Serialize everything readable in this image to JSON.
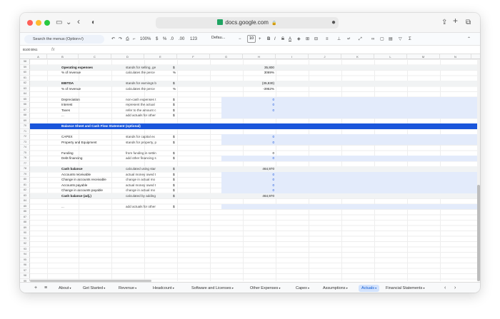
{
  "browser": {
    "url": "docs.google.com",
    "lock": "🔒"
  },
  "toolbar": {
    "search_menus": "Search the menus (Option+/)",
    "zoom": "100%",
    "currency": "$",
    "percent": "%",
    "decimal_less": ".0",
    "decimal_more": ".00",
    "number_format": "123",
    "font": "Defau...",
    "font_size": "10",
    "bold": "B",
    "italic": "I",
    "strike": "S",
    "text_color": "A",
    "minus": "−",
    "plus": "+"
  },
  "formula_bar": {
    "name_box": "B100:BN1",
    "fx": "fx"
  },
  "columns": [
    "A",
    "B",
    "C",
    "D",
    "E",
    "F",
    "G",
    "H",
    "I",
    "J",
    "K",
    "L",
    "M",
    "N"
  ],
  "row_numbers": [
    "58",
    "59",
    "60",
    "61",
    "62",
    "63",
    "64",
    "65",
    "66",
    "67",
    "68",
    "69",
    "70",
    "71",
    "72",
    "73",
    "74",
    "75",
    "76",
    "77",
    "78",
    "79",
    "80",
    "81",
    "82",
    "83",
    "84",
    "85",
    "86",
    "87",
    "88",
    "89",
    "90",
    "91",
    "92",
    "93",
    "94",
    "95",
    "96",
    "97",
    "98",
    "99"
  ],
  "rows": [
    {
      "label": "",
      "desc": "",
      "unit": "",
      "value": "",
      "style": "",
      "blue_bg": false
    },
    {
      "label": "Operating expenses",
      "desc": "stands for selling, ge",
      "unit": "$",
      "value": "35,800",
      "style": "gray bold",
      "blue_bg": false
    },
    {
      "label": "% of revenue",
      "desc": "calculates the perce",
      "unit": "%",
      "value": "3069%",
      "style": "",
      "blue_bg": false
    },
    {
      "label": "",
      "desc": "",
      "unit": "",
      "value": "",
      "style": "",
      "blue_bg": false
    },
    {
      "label": "EBITDA",
      "desc": "stands for earnings b",
      "unit": "$",
      "value": "(35,830)",
      "style": "gray bold",
      "blue_bg": false
    },
    {
      "label": "% of revenue",
      "desc": "calculates the perce",
      "unit": "%",
      "value": "-3952%",
      "style": "",
      "blue_bg": false
    },
    {
      "label": "",
      "desc": "",
      "unit": "",
      "value": "",
      "style": "",
      "blue_bg": false
    },
    {
      "label": "Depreciation",
      "desc": "non-cash expenses t",
      "unit": "$",
      "value": "0",
      "style": "",
      "blue_bg": true
    },
    {
      "label": "Interest",
      "desc": "represent the actual",
      "unit": "$",
      "value": "0",
      "style": "",
      "blue_bg": true
    },
    {
      "label": "Taxes",
      "desc": "refer to the amount c",
      "unit": "$",
      "value": "0",
      "style": "",
      "blue_bg": true
    },
    {
      "label": "...",
      "desc": "add actuals for other",
      "unit": "$",
      "value": "",
      "style": "",
      "blue_bg": true
    },
    {
      "label": "",
      "desc": "",
      "unit": "",
      "value": "",
      "style": "",
      "blue_bg": false
    },
    {
      "label": "Balance Sheet and Cash Flow Statement (optional)",
      "desc": "",
      "unit": "",
      "value": "",
      "style": "banner",
      "blue_bg": false
    },
    {
      "label": "",
      "desc": "",
      "unit": "",
      "value": "",
      "style": "",
      "blue_bg": false
    },
    {
      "label": "CAPEX",
      "desc": "stands for capital ex",
      "unit": "$",
      "value": "0",
      "style": "",
      "blue_bg": true
    },
    {
      "label": "Property and Equipment",
      "desc": "stands for property, p",
      "unit": "$",
      "value": "0",
      "style": "",
      "blue_bg": true
    },
    {
      "label": "",
      "desc": "",
      "unit": "",
      "value": "",
      "style": "",
      "blue_bg": false
    },
    {
      "label": "Funding",
      "desc": "from funding in settin",
      "unit": "$",
      "value": "0",
      "style": "",
      "blue_bg": false
    },
    {
      "label": "Debt financing",
      "desc": "add other financing s",
      "unit": "$",
      "value": "0",
      "style": "",
      "blue_bg": true
    },
    {
      "label": "",
      "desc": "",
      "unit": "",
      "value": "",
      "style": "",
      "blue_bg": false
    },
    {
      "label": "Cash balance",
      "desc": "calculated using star",
      "unit": "$",
      "value": "464,970",
      "style": "gray bold",
      "blue_bg": false
    },
    {
      "label": "Accounts receivable",
      "desc": "actual money owed t",
      "unit": "$",
      "value": "0",
      "style": "",
      "blue_bg": true
    },
    {
      "label": "Change in accounts receivable",
      "desc": "change in actual mo",
      "unit": "$",
      "value": "0",
      "style": "",
      "blue_bg": true
    },
    {
      "label": "Accounts payable",
      "desc": "actual money owed t",
      "unit": "$",
      "value": "0",
      "style": "",
      "blue_bg": true
    },
    {
      "label": "Change in accounts payable",
      "desc": "change in actual mo",
      "unit": "$",
      "value": "0",
      "style": "",
      "blue_bg": true
    },
    {
      "label": "Cash balance (adj.)",
      "desc": "calculated by adding",
      "unit": "$",
      "value": "464,970",
      "style": "gray bold",
      "blue_bg": false
    },
    {
      "label": "",
      "desc": "",
      "unit": "",
      "value": "",
      "style": "",
      "blue_bg": false
    },
    {
      "label": "...",
      "desc": "add actuals for other",
      "unit": "$",
      "value": "",
      "style": "",
      "blue_bg": true
    }
  ],
  "sheet_tabs": [
    {
      "label": "About",
      "active": false
    },
    {
      "label": "Get Started",
      "active": false
    },
    {
      "label": "Revenue",
      "active": false
    },
    {
      "label": "Headcount",
      "active": false
    },
    {
      "label": "Software and Licenses",
      "active": false
    },
    {
      "label": "Other Expenses",
      "active": false
    },
    {
      "label": "Capex",
      "active": false
    },
    {
      "label": "Assumptions",
      "active": false
    },
    {
      "label": "Actuals",
      "active": true
    },
    {
      "label": "Financial Statements",
      "active": false
    }
  ],
  "colors": {
    "banner": "#1a56db",
    "input_blue": "#1a56db",
    "active_tab": "#d3e3fd"
  }
}
